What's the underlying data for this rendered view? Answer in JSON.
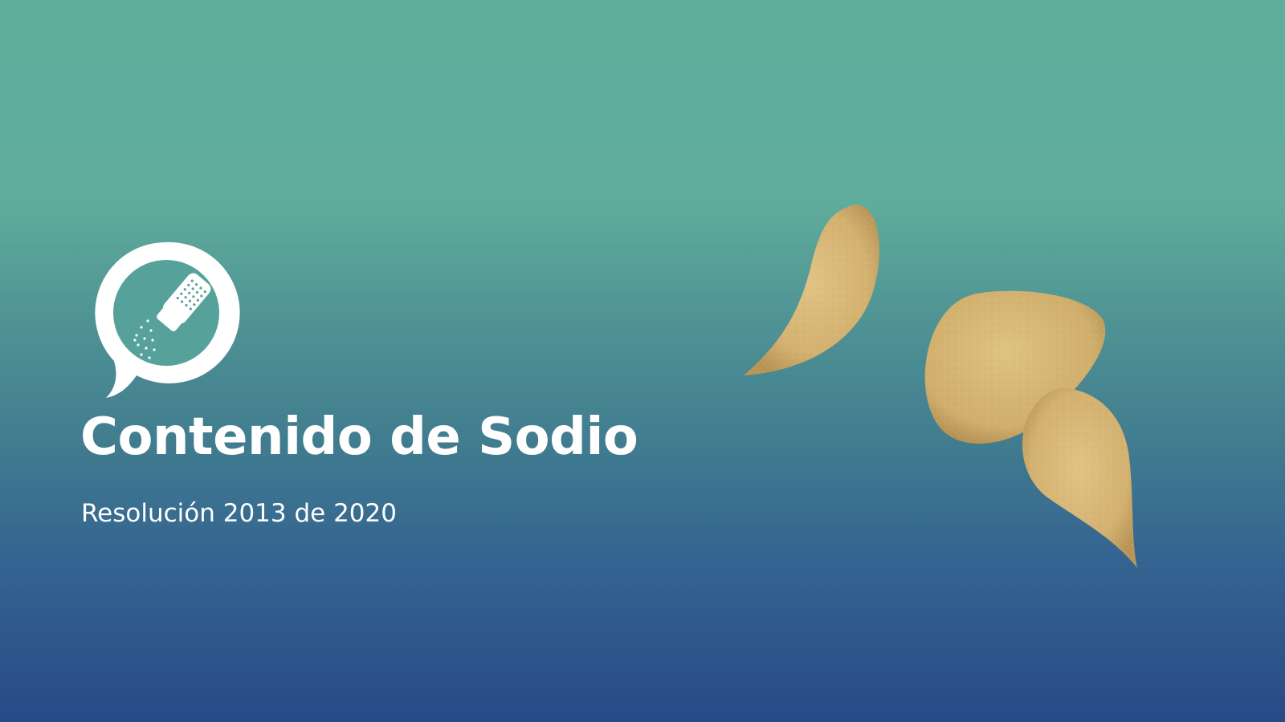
{
  "slide": {
    "title": "Contenido de Sodio",
    "subtitle": "Resolución 2013 de 2020"
  },
  "colors": {
    "gradient_top": "#5fae9c",
    "gradient_bottom": "#284a87",
    "text": "#ffffff",
    "chip": "#d6b676"
  },
  "icons": {
    "logo": "salt-shaker-speech-bubble-icon",
    "decor": "potato-chips"
  }
}
